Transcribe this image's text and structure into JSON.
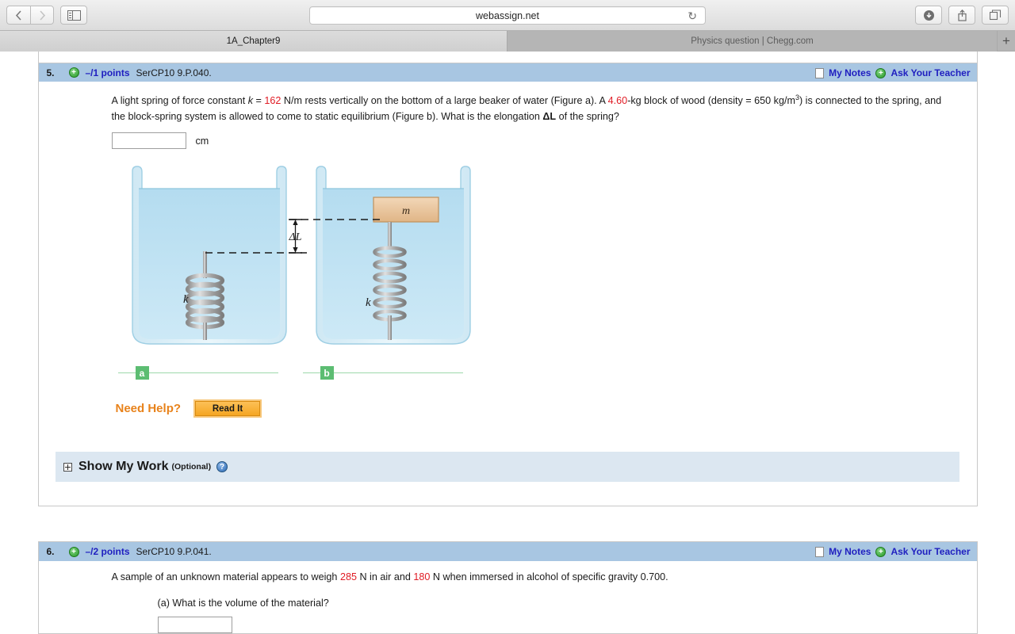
{
  "browser": {
    "url": "webassign.net",
    "back_icon": "chevron-left-icon",
    "forward_icon": "chevron-right-icon",
    "sidebar_icon": "sidebar-toggle-icon",
    "reload_icon": "reload-icon",
    "downloads_icon": "downloads-icon",
    "share_icon": "share-icon",
    "tabs_icon": "show-tabs-icon",
    "new_tab_label": "+",
    "tabs": [
      {
        "title": "1A_Chapter9",
        "active": true
      },
      {
        "title": "Physics question | Chegg.com",
        "active": false
      }
    ]
  },
  "questions": [
    {
      "number": "5.",
      "points": "–/1 points",
      "code": "SerCP10 9.P.040.",
      "my_notes": "My Notes",
      "ask_teacher": "Ask Your Teacher",
      "text_parts": {
        "p1": "A light spring of force constant ",
        "k_sym": "k",
        "eq": " = ",
        "k_value": "162",
        "p2": " N/m rests vertically on the bottom of a large beaker of water (Figure a). A ",
        "mass_value": "4.60",
        "p3": "-kg block of wood (density = 650 kg/m",
        "exp": "3",
        "p4": ") is connected to the spring, and the block-spring system is allowed to come to static equilibrium (Figure b). What is the elongation ",
        "delta_sym": "ΔL",
        "p5": " of the spring?"
      },
      "answer": {
        "value": "",
        "placeholder": "",
        "unit": "cm"
      },
      "figure": {
        "delta_label": "ΔL",
        "spring_label_a": "k",
        "spring_label_b": "k",
        "mass_label": "m",
        "caption_a": "a",
        "caption_b": "b"
      },
      "need_help": {
        "label": "Need Help?",
        "read_it": "Read It"
      },
      "show_my_work": {
        "title": "Show My Work",
        "optional": "(Optional)",
        "help_icon": "help-icon"
      }
    },
    {
      "number": "6.",
      "points": "–/2 points",
      "code": "SerCP10 9.P.041.",
      "my_notes": "My Notes",
      "ask_teacher": "Ask Your Teacher",
      "text_parts": {
        "p1": "A sample of an unknown material appears to weigh ",
        "w_air": "285",
        "p2": " N in air and ",
        "w_alc": "180",
        "p3": " N when immersed in alcohol of specific gravity 0.700."
      },
      "sub_a": "(a) What is the volume of the material?"
    }
  ],
  "colors": {
    "header_blue": "#a8c6e2",
    "link_blue": "#2020c0",
    "highlight_red": "#e01b24",
    "orange": "#e8821a",
    "green": "#5cbd72",
    "water": "#a8d8ee"
  }
}
